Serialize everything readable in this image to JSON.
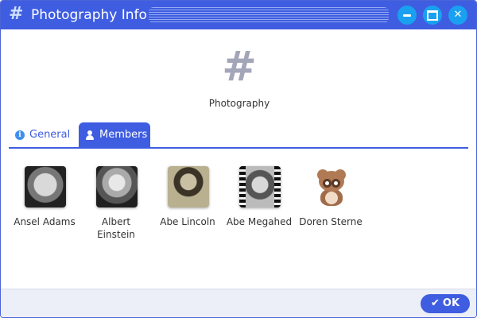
{
  "window": {
    "title": "Photography Info",
    "title_icon": "hash-icon",
    "controls": [
      "minimize",
      "maximize",
      "close"
    ],
    "accent_color": "#3f5de0"
  },
  "group": {
    "icon": "hash-icon",
    "name": "Photography"
  },
  "tabs": [
    {
      "label": "General",
      "icon": "info-icon",
      "active": false
    },
    {
      "label": "Members",
      "icon": "user-icon",
      "active": true
    }
  ],
  "members": [
    {
      "name": "Ansel Adams",
      "avatar": "portrait-photo"
    },
    {
      "name": "Albert Einstein",
      "avatar": "portrait-photo"
    },
    {
      "name": "Abe Lincoln",
      "avatar": "portrait-photo"
    },
    {
      "name": "Abe Megahed",
      "avatar": "film-strip-photo"
    },
    {
      "name": "Doren Sterne",
      "avatar": "teddy-bear-icon"
    }
  ],
  "footer": {
    "ok_label": "OK",
    "ok_icon": "check-icon"
  }
}
